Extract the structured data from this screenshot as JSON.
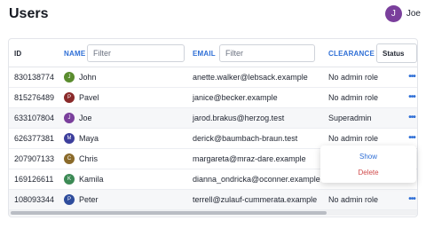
{
  "page": {
    "title": "Users"
  },
  "current_user": {
    "initial": "J",
    "name": "Joe",
    "color": "#7a3f9c"
  },
  "table": {
    "columns": {
      "id": "ID",
      "name": "NAME",
      "email": "EMAIL",
      "clearance": "CLEARANCE",
      "status": "Status"
    },
    "filters": {
      "name_placeholder": "Filter",
      "email_placeholder": "Filter"
    },
    "row_action_icon": "more-horizontal-icon",
    "rows": [
      {
        "id": "830138774",
        "initial": "J",
        "color": "#5a8c2e",
        "name": "John",
        "email": "anette.walker@lebsack.example",
        "clearance": "No admin role"
      },
      {
        "id": "815276489",
        "initial": "P",
        "color": "#8a2a2a",
        "name": "Pavel",
        "email": "janice@becker.example",
        "clearance": "No admin role"
      },
      {
        "id": "633107804",
        "initial": "J",
        "color": "#7a3f9c",
        "name": "Joe",
        "email": "jarod.brakus@herzog.test",
        "clearance": "Superadmin"
      },
      {
        "id": "626377381",
        "initial": "M",
        "color": "#3d3f9c",
        "name": "Maya",
        "email": "derick@baumbach-braun.test",
        "clearance": "No admin role"
      },
      {
        "id": "207907133",
        "initial": "C",
        "color": "#8a6a2a",
        "name": "Chris",
        "email": "margareta@mraz-dare.example",
        "clearance": ""
      },
      {
        "id": "169126611",
        "initial": "K",
        "color": "#3c8a55",
        "name": "Kamila",
        "email": "dianna_ondricka@oconner.example",
        "clearance": ""
      },
      {
        "id": "108093344",
        "initial": "P",
        "color": "#2e4c9c",
        "name": "Peter",
        "email": "terrell@zulauf-cummerata.example",
        "clearance": "No admin role"
      }
    ]
  },
  "context_menu": {
    "show": "Show",
    "delete": "Delete"
  },
  "colors": {
    "accent": "#2f6fd6",
    "danger": "#d04b4b"
  }
}
